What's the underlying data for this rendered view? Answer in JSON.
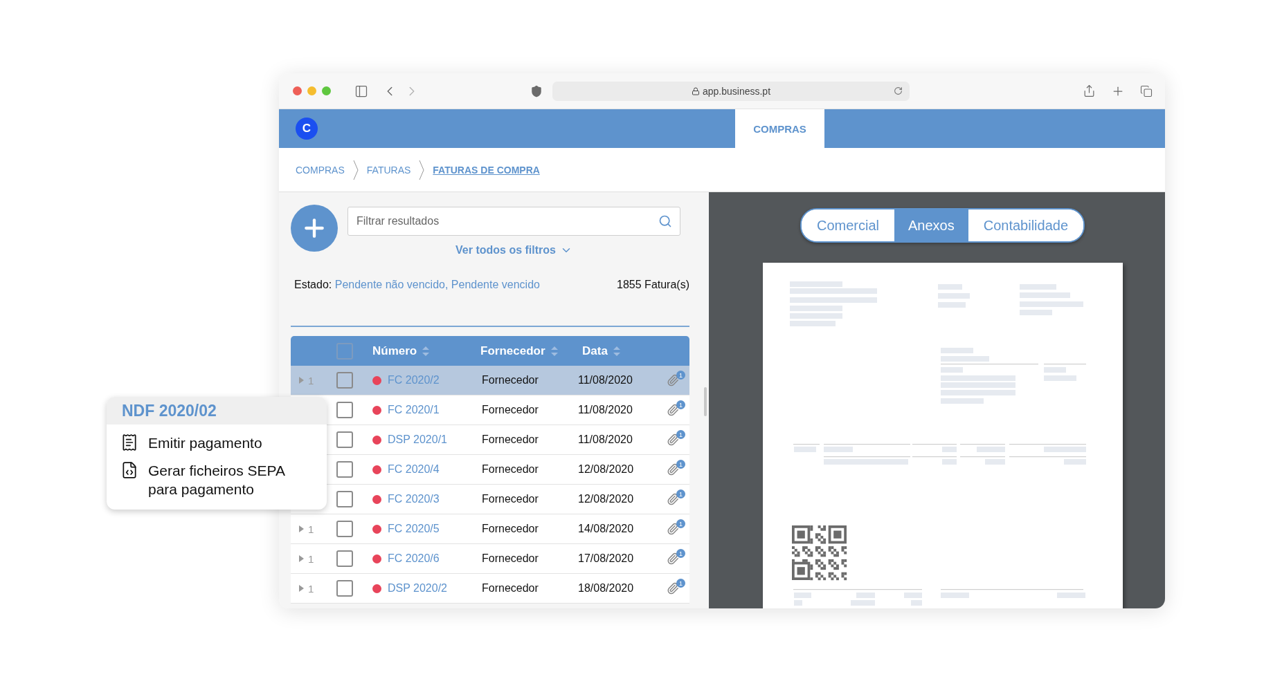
{
  "browser": {
    "url": "app.business.pt"
  },
  "app_bar": {
    "logo": "C",
    "tabs": [
      {
        "label": "COMPRAS",
        "selected": true
      }
    ]
  },
  "breadcrumbs": [
    {
      "label": "COMPRAS",
      "current": false
    },
    {
      "label": "FATURAS",
      "current": false
    },
    {
      "label": "FATURAS DE COMPRA",
      "current": true
    }
  ],
  "search": {
    "placeholder": "Filtrar resultados"
  },
  "filters_link": "Ver todos os filtros",
  "status_filter": {
    "label": "Estado:",
    "value": "Pendente não vencido, Pendente vencido"
  },
  "result_count": "1855 Fatura(s)",
  "table": {
    "header_checked": false,
    "columns": [
      {
        "label": "Número",
        "sortable": true
      },
      {
        "label": "Fornecedor",
        "sortable": true
      },
      {
        "label": "Data",
        "sortable": true
      }
    ],
    "rows": [
      {
        "expander": "1",
        "checked": false,
        "selected": true,
        "color": "#e8445a",
        "number": "FC 2020/2",
        "supplier": "Fornecedor",
        "date": "11/08/2020",
        "attachments": "1"
      },
      {
        "checked": false,
        "selected": false,
        "color": "#e8445a",
        "number": "FC 2020/1",
        "supplier": "Fornecedor",
        "date": "11/08/2020",
        "attachments": "1"
      },
      {
        "checked": false,
        "selected": false,
        "color": "#e8445a",
        "number": "DSP 2020/1",
        "supplier": "Fornecedor",
        "date": "11/08/2020",
        "attachments": "1"
      },
      {
        "checked": false,
        "selected": false,
        "color": "#e8445a",
        "number": "FC 2020/4",
        "supplier": "Fornecedor",
        "date": "12/08/2020",
        "attachments": "1"
      },
      {
        "checked": false,
        "selected": false,
        "color": "#e8445a",
        "number": "FC 2020/3",
        "supplier": "Fornecedor",
        "date": "12/08/2020",
        "attachments": "1"
      },
      {
        "expander": "1",
        "checked": false,
        "selected": false,
        "color": "#e8445a",
        "number": "FC 2020/5",
        "supplier": "Fornecedor",
        "date": "14/08/2020",
        "attachments": "1"
      },
      {
        "expander": "1",
        "checked": false,
        "selected": false,
        "color": "#e8445a",
        "number": "FC 2020/6",
        "supplier": "Fornecedor",
        "date": "17/08/2020",
        "attachments": "1"
      },
      {
        "expander": "1",
        "checked": false,
        "selected": false,
        "color": "#e8445a",
        "number": "DSP 2020/2",
        "supplier": "Fornecedor",
        "date": "18/08/2020",
        "attachments": "1"
      }
    ]
  },
  "context_menu": {
    "title": "NDF 2020/02",
    "items": [
      {
        "kind": "receipt",
        "label": "Emitir pagamento"
      },
      {
        "kind": "code-file",
        "label": "Gerar ficheiros SEPA para pagamento"
      }
    ]
  },
  "viewer": {
    "tabs": [
      {
        "label": "Comercial",
        "selected": false
      },
      {
        "label": "Anexos",
        "selected": true
      },
      {
        "label": "Contabilidade",
        "selected": false
      }
    ]
  }
}
